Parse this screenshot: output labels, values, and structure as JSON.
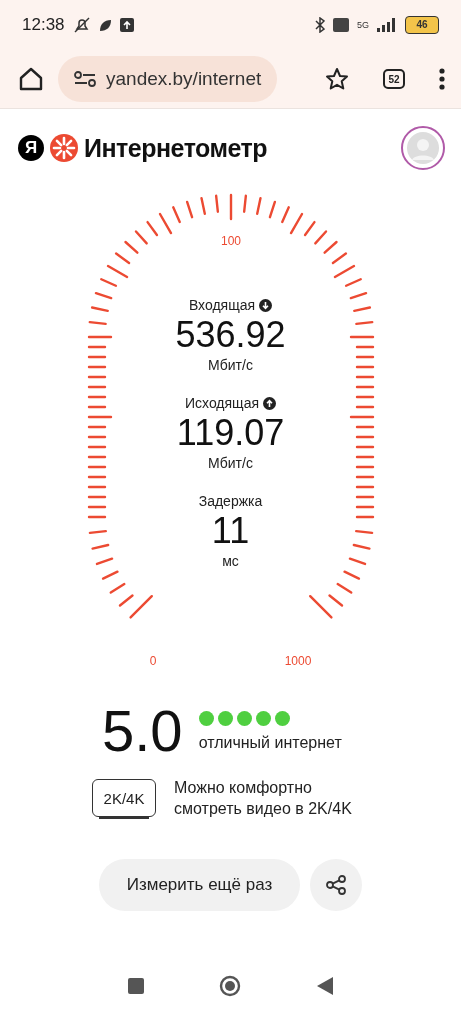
{
  "status_bar": {
    "time": "12:38",
    "network": "5G",
    "battery": "46"
  },
  "browser": {
    "url": "yandex.by/internet",
    "tab_count": "52"
  },
  "header": {
    "logo_letter": "Я",
    "title": "Интернетометр"
  },
  "gauge": {
    "scale_labels": [
      "0",
      "100",
      "1000"
    ],
    "metrics": [
      {
        "kind": "download",
        "label": "Входящая",
        "value": "536.92",
        "unit": "Мбит/с"
      },
      {
        "kind": "upload",
        "label": "Исходящая",
        "value": "119.07",
        "unit": "Мбит/с"
      },
      {
        "kind": "latency",
        "label": "Задержка",
        "value": "11",
        "unit": "мс"
      }
    ]
  },
  "rating": {
    "score": "5.0",
    "stars": 5,
    "verdict": "отличный интернет"
  },
  "quality": {
    "badge": "2K/4K",
    "text": "Можно комфортно смотреть видео в 2K/4K"
  },
  "actions": {
    "retry": "Измерить ещё раз"
  }
}
